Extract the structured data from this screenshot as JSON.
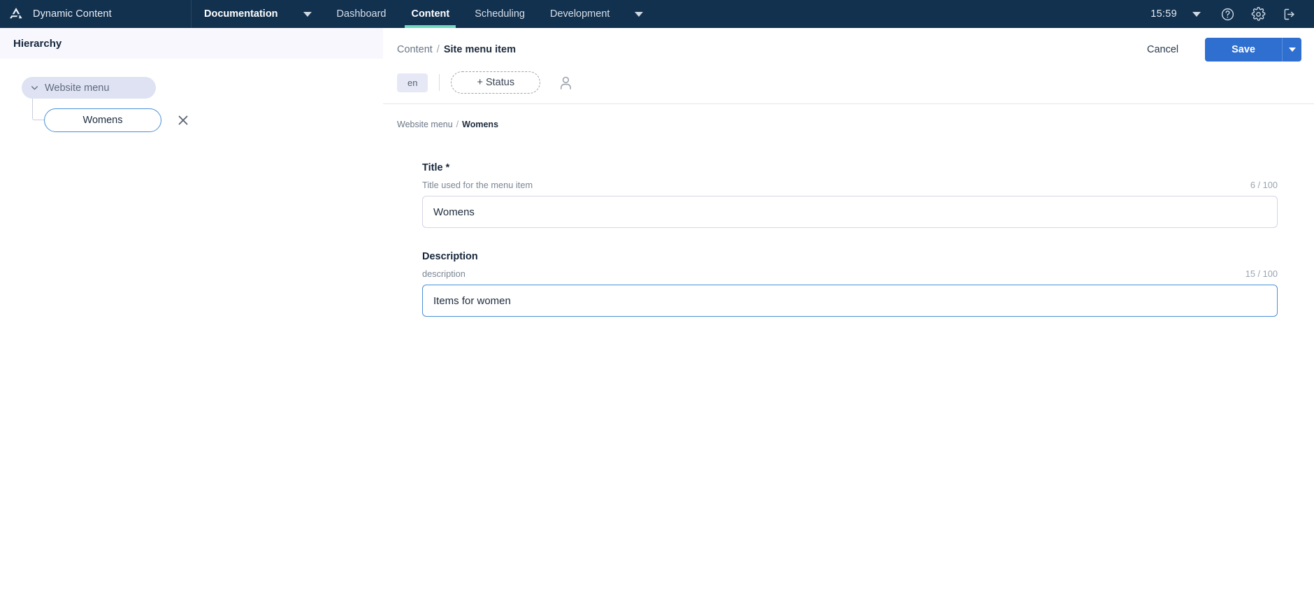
{
  "topnav": {
    "brand": "Dynamic Content",
    "logo_icon": "amplience-logo-icon",
    "items": [
      {
        "label": "Documentation",
        "bold": true,
        "active": false,
        "has_caret": true
      },
      {
        "label": "Dashboard",
        "bold": false,
        "active": false,
        "has_caret": false
      },
      {
        "label": "Content",
        "bold": true,
        "active": true,
        "has_caret": false
      },
      {
        "label": "Scheduling",
        "bold": false,
        "active": false,
        "has_caret": false
      },
      {
        "label": "Development",
        "bold": false,
        "active": false,
        "has_caret": true
      }
    ],
    "clock": "15:59",
    "account_caret_icon": "chevron-down-icon",
    "help_icon": "help-circle-icon",
    "settings_icon": "gear-icon",
    "logout_icon": "logout-icon",
    "accent_active": "#6fd9bd",
    "background": "#12314f"
  },
  "hierarchy": {
    "header_title": "Hierarchy",
    "root": {
      "label": "Website menu",
      "expand_icon": "chevron-down-icon",
      "expanded": true
    },
    "child": {
      "label": "Womens",
      "selected": true,
      "remove_icon": "close-icon"
    }
  },
  "content": {
    "breadcrumb": {
      "parent": "Content",
      "separator": "/",
      "current": "Site menu item"
    },
    "cancel_label": "Cancel",
    "save_label": "Save",
    "save_caret_icon": "chevron-down-icon",
    "save_color": "#2f6fd0",
    "language_badge": "en",
    "status_label": "+ Status",
    "assignee_icon": "user-icon",
    "sub_breadcrumb": {
      "parent": "Website menu",
      "separator": "/",
      "current": "Womens"
    },
    "fields": [
      {
        "label": "Title *",
        "help": "Title used for the menu item",
        "count": "6 / 100",
        "value": "Womens",
        "placeholder": "",
        "focused": false
      },
      {
        "label": "Description",
        "help": "description",
        "count": "15 / 100",
        "value": "Items for women",
        "placeholder": "",
        "focused": true
      }
    ]
  }
}
